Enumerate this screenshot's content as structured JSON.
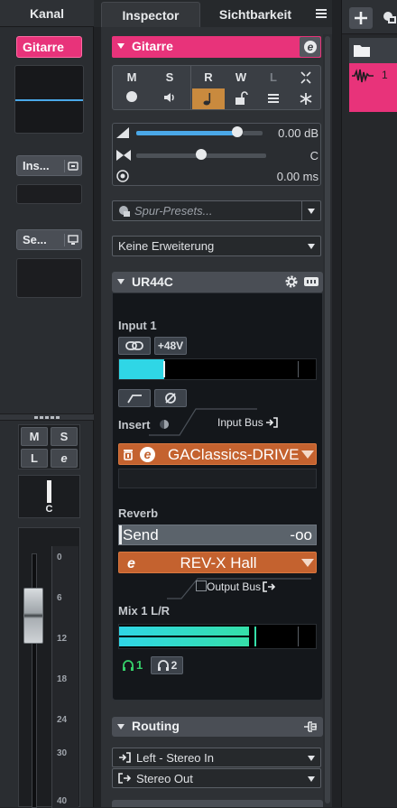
{
  "channel": {
    "tab_label": "Kanal",
    "track_name": "Gitarre",
    "inserts_label": "Ins...",
    "sends_label": "Se...",
    "m": "M",
    "s": "S",
    "l": "L",
    "e": "e",
    "pan_label": "C",
    "fader_scale": [
      "0",
      "6",
      "12",
      "18",
      "24",
      "30",
      "40"
    ]
  },
  "inspector": {
    "tabs": [
      "Inspector",
      "Sichtbarkeit"
    ],
    "track_name": "Gitarre",
    "buttons_top": [
      "M",
      "S",
      "R",
      "W",
      "L"
    ],
    "volume_value": "0.00 dB",
    "pan_value": "C",
    "delay_value": "0.00 ms",
    "presets_placeholder": "Spur-Presets...",
    "extension_value": "Keine Erweiterung",
    "device_section": "UR44C",
    "routing_section": "Routing",
    "routing_in": "Left - Stereo In",
    "routing_out": "Stereo Out"
  },
  "ur44c": {
    "input_label": "Input 1",
    "phantom_label": "+48V",
    "input_meter_level": 0.23,
    "insert_label": "Insert",
    "input_bus_label": "Input Bus",
    "insert_plugin": "GAClassics-DRIVE",
    "reverb_label": "Reverb",
    "send_label": "Send",
    "send_value": "-oo",
    "reverb_plugin": "REV-X Hall",
    "output_bus_label": "Output Bus",
    "mix_label": "Mix 1 L/R",
    "mix_meter_level": 0.72,
    "headphone_1": "1",
    "headphone_2": "2"
  },
  "project": {
    "track_number": "1",
    "track_color": "#e8337a"
  },
  "colors": {
    "accent_pink": "#e8337a",
    "accent_blue": "#4aa8e8",
    "meter_cyan": "#2fd6e6",
    "plugin_orange": "#c4622f",
    "record_orange": "#c98a3e"
  }
}
